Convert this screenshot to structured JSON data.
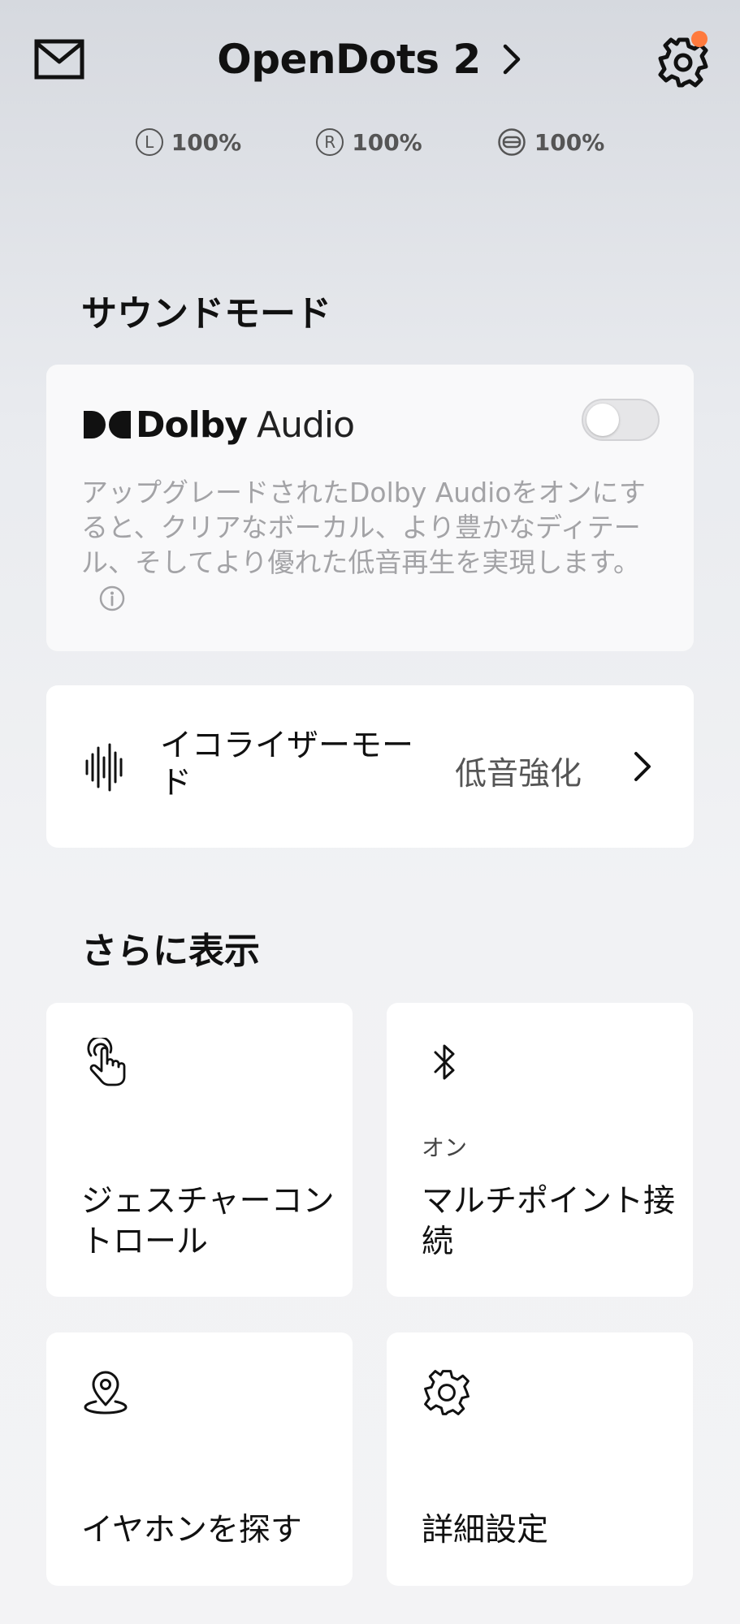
{
  "header": {
    "title": "OpenDots 2",
    "icons": {
      "mail": "mail-icon",
      "settings": "gear-icon",
      "chevron": "chevron-right-icon"
    },
    "notification_color": "#ff7a3d"
  },
  "battery": [
    {
      "side": "L",
      "level": "100%"
    },
    {
      "side": "R",
      "level": "100%"
    },
    {
      "side": "case",
      "level": "100%"
    }
  ],
  "sound_mode": {
    "section_title": "サウンドモード",
    "dolby": {
      "brand": "Dolby",
      "product": "Audio",
      "enabled": false,
      "description": "アップグレードされたDolby Audioをオンにすると、クリアなボーカル、より豊かなディテール、そしてより優れた低音再生を実現します。"
    },
    "equalizer": {
      "label": "イコライザーモード",
      "value": "低音強化"
    }
  },
  "more": {
    "section_title": "さらに表示",
    "tiles": [
      {
        "label": "ジェスチャーコントロール",
        "icon": "touch-gesture-icon"
      },
      {
        "label": "マルチポイント接続",
        "status": "オン",
        "icon": "bluetooth-icon"
      },
      {
        "label": "イヤホンを探す",
        "icon": "location-pin-icon"
      },
      {
        "label": "詳細設定",
        "icon": "gear-icon"
      }
    ]
  }
}
